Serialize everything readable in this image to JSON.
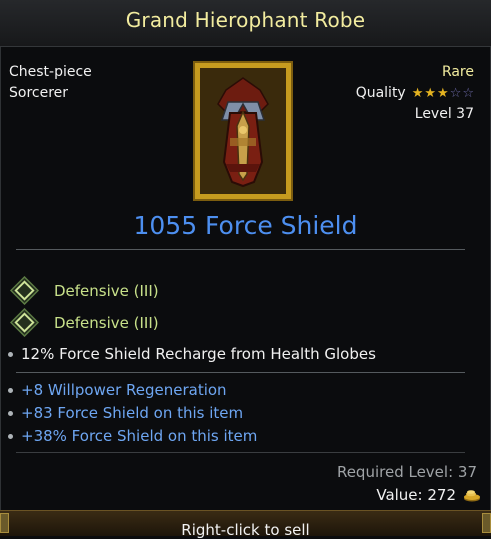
{
  "item": {
    "name": "Grand Hierophant Robe",
    "slot": "Chest-piece",
    "class": "Sorcerer",
    "rarity": "Rare",
    "quality_label": "Quality",
    "quality_stars": 3,
    "quality_max": 5,
    "level": "Level 37",
    "primary_stat": "1055 Force Shield"
  },
  "sockets": [
    {
      "label": "Defensive (III)",
      "icon": "diamond-gem-icon"
    },
    {
      "label": "Defensive (III)",
      "icon": "diamond-gem-icon"
    }
  ],
  "implicit": "12% Force Shield Recharge from Health Globes",
  "affixes": [
    "+8 Willpower Regeneration",
    "+83 Force Shield on this item",
    "+38% Force Shield on this item"
  ],
  "requirements": {
    "required_level": "Required Level: 37",
    "value": "Value: 272",
    "value_icon": "gold-coins-icon"
  },
  "footer": {
    "action": "Right-click to sell"
  },
  "colors": {
    "title": "#f2ec9f",
    "primary_stat": "#4d8ff0",
    "affix": "#6ea6f2",
    "socket": "#c8e18a",
    "star_full": "#e4b321",
    "star_empty": "#6c6aa8"
  }
}
